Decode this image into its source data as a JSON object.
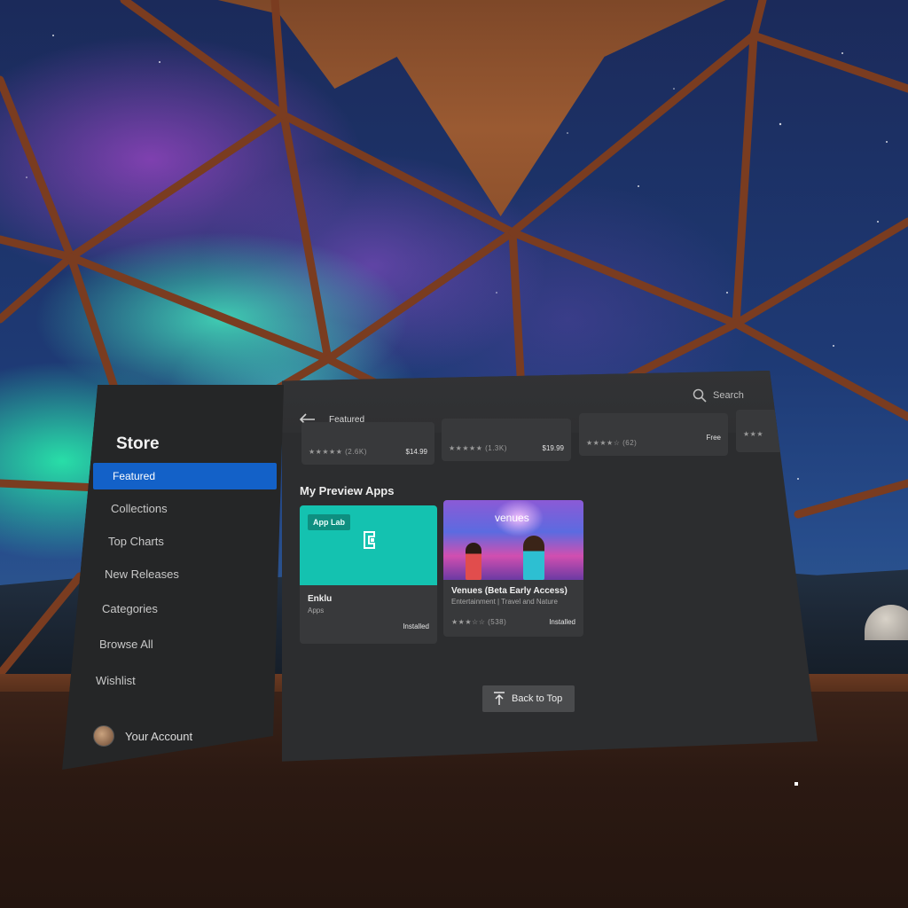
{
  "sidebar": {
    "title": "Store",
    "items": [
      {
        "label": "Featured"
      },
      {
        "label": "Collections"
      },
      {
        "label": "Top Charts"
      },
      {
        "label": "New Releases"
      },
      {
        "label": "Categories"
      },
      {
        "label": "Browse All"
      },
      {
        "label": "Wishlist"
      }
    ],
    "account_label": "Your Account"
  },
  "header": {
    "breadcrumb": "Featured",
    "search_label": "Search"
  },
  "previous_row": [
    {
      "rating": "★★★★★ (2.6K)",
      "price": "$14.99"
    },
    {
      "rating": "★★★★★ (1.3K)",
      "price": "$19.99"
    },
    {
      "rating": "★★★★☆ (62)",
      "price": "Free"
    },
    {
      "rating": "★★★",
      "price": ""
    }
  ],
  "section": {
    "title": "My Preview Apps"
  },
  "apps": [
    {
      "badge": "App Lab",
      "logo_text": "Enklu",
      "title": "Enklu",
      "subtitle": "Apps",
      "rating": "",
      "status": "Installed"
    },
    {
      "logo_text": "venues",
      "title": "Venues (Beta Early Access)",
      "subtitle": "Entertainment | Travel and Nature",
      "rating": "★★★☆☆ (538)",
      "status": "Installed"
    }
  ],
  "back_to_top": "Back to Top",
  "colors": {
    "accent": "#1361c8",
    "app_lab_teal": "#14c2b0",
    "panel": "#2c2d2f",
    "sidebar": "#252627"
  },
  "icons": [
    "back-arrow-icon",
    "search-icon",
    "arrow-up-icon",
    "enklu-logo-icon"
  ]
}
